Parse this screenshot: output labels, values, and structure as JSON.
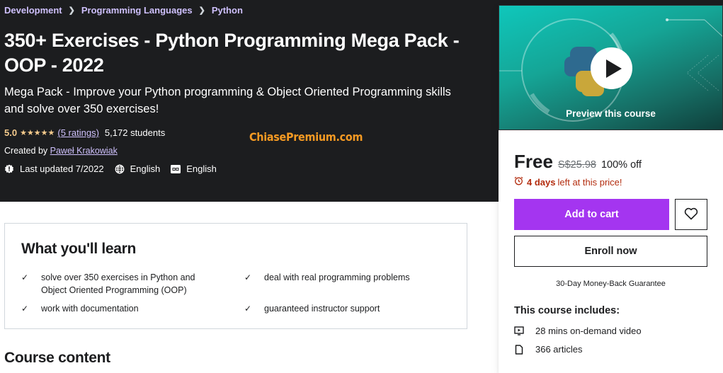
{
  "breadcrumb": [
    "Development",
    "Programming Languages",
    "Python"
  ],
  "course": {
    "title": "350+ Exercises - Python Programming Mega Pack - OOP - 2022",
    "subtitle": "Mega Pack - Improve your Python programming & Object Oriented Programming skills and solve over 350 exercises!",
    "rating": "5.0",
    "stars": "★★★★★",
    "stars_value": 5,
    "ratings_link": "(5 ratings)",
    "students": "5,172 students",
    "created_by_label": "Created by",
    "instructor": "Paweł Krakowiak",
    "last_updated": "Last updated 7/2022",
    "language": "English",
    "captions": "English"
  },
  "watermark": "ChiasePremium.com",
  "sidebar": {
    "preview_label": "Preview this course",
    "price": "Free",
    "original_price": "S$25.98",
    "discount": "100% off",
    "timer_bold": "4 days",
    "timer_rest": "left at this price!",
    "add_to_cart": "Add to cart",
    "enroll_now": "Enroll now",
    "guarantee": "30-Day Money-Back Guarantee",
    "includes_title": "This course includes:",
    "includes": [
      {
        "icon": "video-icon",
        "label": "28 mins on-demand video"
      },
      {
        "icon": "file-icon",
        "label": "366 articles"
      }
    ]
  },
  "learn": {
    "title": "What you'll learn",
    "items": [
      "solve over 350 exercises in Python and Object Oriented Programming (OOP)",
      "deal with real programming problems",
      "work with documentation",
      "guaranteed instructor support"
    ]
  },
  "course_content_title": "Course content",
  "colors": {
    "hero_bg": "#1c1d1f",
    "accent_purple": "#a435f0",
    "link_purple": "#cec0fc",
    "star_gold": "#f3ca8c",
    "timer_red": "#b32d0f",
    "watermark_orange": "#f59a23"
  }
}
